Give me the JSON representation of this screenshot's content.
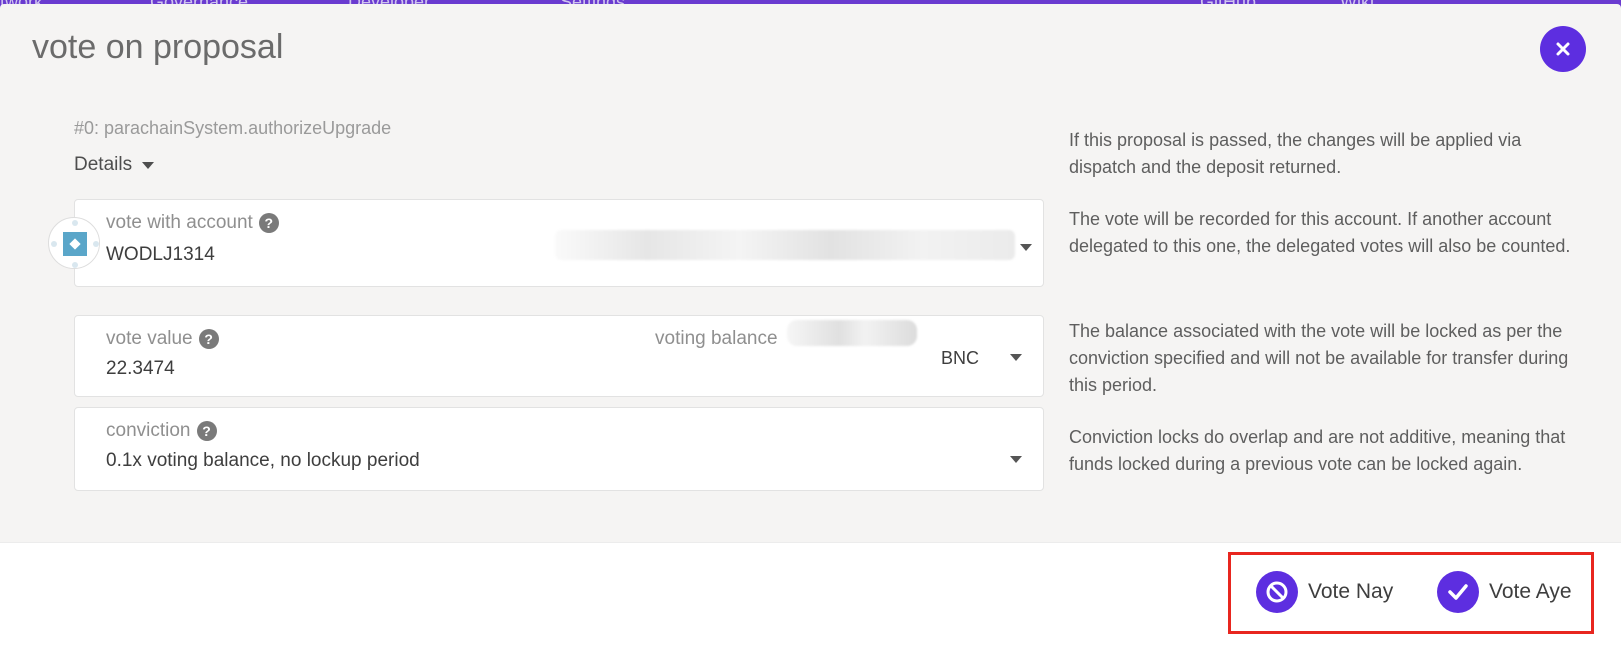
{
  "background_nav": {
    "items": [
      "twork",
      "Governance",
      "Developer",
      "Settings",
      "GitHub",
      "Wiki"
    ]
  },
  "modal": {
    "title": "vote on proposal",
    "close_icon": "close-icon",
    "proposal": "#0: parachainSystem.authorizeUpgrade",
    "details_label": "Details",
    "account": {
      "label": "vote with account",
      "value": "WODLJ1314",
      "help": "?"
    },
    "vote_value": {
      "label": "vote value",
      "help": "?",
      "value": "22.3474",
      "voting_balance_label": "voting balance",
      "unit": "BNC"
    },
    "conviction": {
      "label": "conviction",
      "help": "?",
      "value": "0.1x voting balance, no lockup period"
    },
    "help_texts": {
      "proposal": "If this proposal is passed, the changes will be applied via dispatch and the deposit returned.",
      "account": "The vote will be recorded for this account. If another account delegated to this one, the delegated votes will also be counted.",
      "value": "The balance associated with the vote will be locked as per the conviction specified and will not be available for transfer during this period.",
      "conviction": "Conviction locks do overlap and are not additive, meaning that funds locked during a previous vote can be locked again."
    },
    "buttons": {
      "nay": "Vote Nay",
      "aye": "Vote Aye"
    }
  },
  "colors": {
    "accent": "#5d2ee0",
    "highlight": "#e8261f",
    "topbar": "#6a3bd0"
  }
}
